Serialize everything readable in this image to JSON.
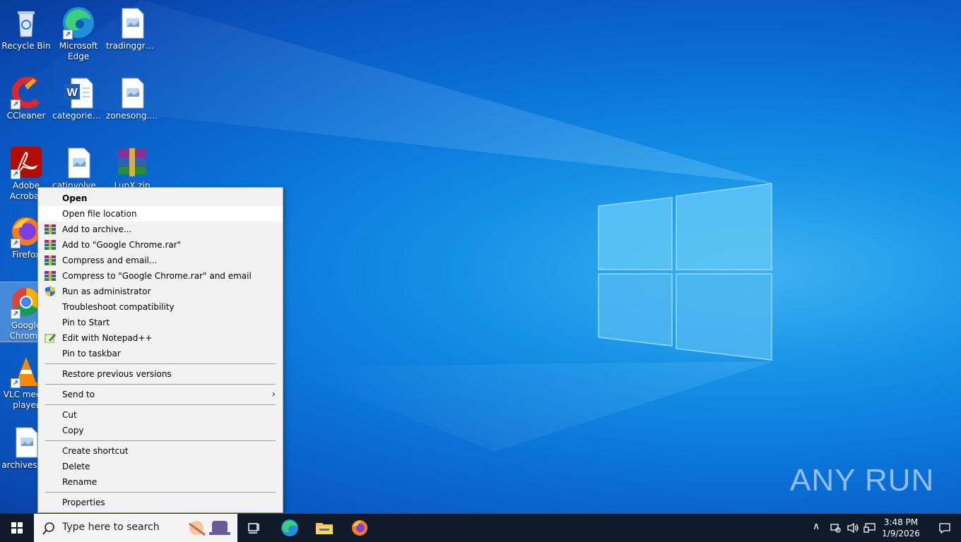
{
  "desktop": {
    "icons": [
      {
        "label": "Recycle Bin"
      },
      {
        "label": "Microsoft Edge"
      },
      {
        "label": "tradinggra..."
      },
      {
        "label": "CCleaner"
      },
      {
        "label": "categoriesd..."
      },
      {
        "label": "zonesong.jpg"
      },
      {
        "label": "Adobe Acrobat"
      },
      {
        "label": "catinvolved..."
      },
      {
        "label": "LunX.zip"
      },
      {
        "label": "Firefox"
      },
      {
        "label": "Google Chrome"
      },
      {
        "label": "VLC media player"
      },
      {
        "label": "archivesg..."
      }
    ]
  },
  "context_menu": {
    "items": [
      {
        "label": "Open"
      },
      {
        "label": "Open file location"
      },
      {
        "label": "Add to archive..."
      },
      {
        "label": "Add to \"Google Chrome.rar\""
      },
      {
        "label": "Compress and email..."
      },
      {
        "label": "Compress to \"Google Chrome.rar\" and email"
      },
      {
        "label": "Run as administrator"
      },
      {
        "label": "Troubleshoot compatibility"
      },
      {
        "label": "Pin to Start"
      },
      {
        "label": "Edit with Notepad++"
      },
      {
        "label": "Pin to taskbar"
      },
      {
        "label": "Restore previous versions"
      },
      {
        "label": "Send to"
      },
      {
        "label": "Cut"
      },
      {
        "label": "Copy"
      },
      {
        "label": "Create shortcut"
      },
      {
        "label": "Delete"
      },
      {
        "label": "Rename"
      },
      {
        "label": "Properties"
      }
    ]
  },
  "taskbar": {
    "search_placeholder": "Type here to search",
    "time": "3:48 PM",
    "date": "1/9/2026"
  },
  "watermark": "ANY RUN",
  "colors": {
    "accent": "#0a6fd6",
    "taskbar": "#0f1a2a",
    "menu_bg": "#f2f2f2"
  }
}
